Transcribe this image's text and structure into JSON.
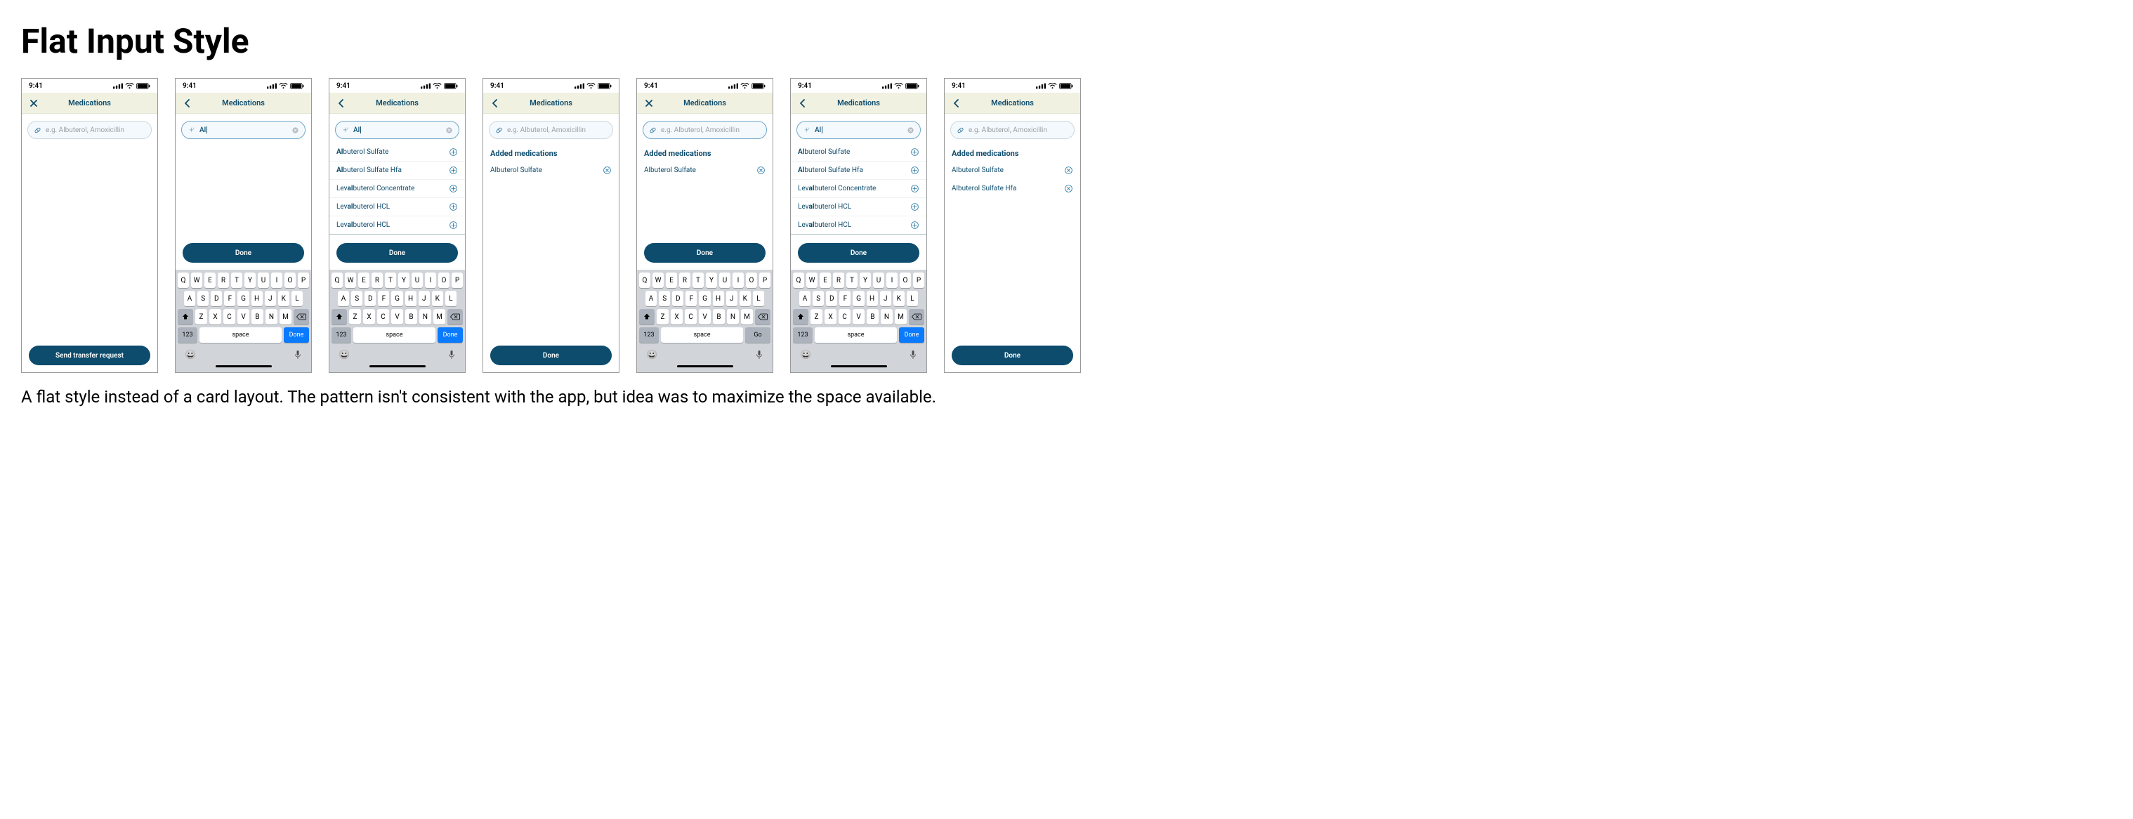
{
  "title": "Flat Input Style",
  "caption": "A flat style instead of a card layout. The pattern isn't consistent with the app, but idea was to maximize the space available.",
  "common": {
    "time": "9:41",
    "nav_title": "Medications",
    "placeholder": "e.g. Albuterol, Amoxicillin",
    "done": "Done",
    "send": "Send transfer request",
    "section_added": "Added medications",
    "kb": {
      "r1": [
        "Q",
        "W",
        "E",
        "R",
        "T",
        "Y",
        "U",
        "I",
        "O",
        "P"
      ],
      "r2": [
        "A",
        "S",
        "D",
        "F",
        "G",
        "H",
        "J",
        "K",
        "L"
      ],
      "r3": [
        "Z",
        "X",
        "C",
        "V",
        "B",
        "N",
        "M"
      ],
      "k123": "123",
      "space": "space",
      "action_done": "Done",
      "action_go": "Go"
    }
  },
  "screens": [
    {
      "nav_left": "close",
      "input": {
        "state": "idle",
        "value": "",
        "leading": "pill",
        "clear": false
      },
      "body": "empty",
      "keyboard": false,
      "footer_btn": "send"
    },
    {
      "nav_left": "back",
      "input": {
        "state": "active",
        "value": "Al",
        "leading": "sparkle",
        "clear": true
      },
      "body": "empty",
      "keyboard": true,
      "keyboard_action": "done",
      "done_above_kb": true
    },
    {
      "nav_left": "back",
      "input": {
        "state": "active",
        "value": "Al",
        "leading": "sparkle",
        "clear": true
      },
      "body": "results",
      "results": [
        {
          "pre": "",
          "match": "Al",
          "post": "buterol Sulfate"
        },
        {
          "pre": "",
          "match": "Al",
          "post": "buterol Sulfate Hfa"
        },
        {
          "pre": "Lev",
          "match": "al",
          "post": "buterol Concentrate"
        },
        {
          "pre": "Lev",
          "match": "al",
          "post": "buterol HCL"
        },
        {
          "pre": "Lev",
          "match": "al",
          "post": "buterol HCL"
        }
      ],
      "keyboard": true,
      "keyboard_action": "done",
      "done_above_kb": true
    },
    {
      "nav_left": "back",
      "input": {
        "state": "idle",
        "value": "",
        "leading": "pill",
        "clear": false
      },
      "body": "added",
      "added": [
        "Albuterol Sulfate"
      ],
      "keyboard": false,
      "footer_btn": "done"
    },
    {
      "nav_left": "close",
      "input": {
        "state": "active",
        "value": "",
        "leading": "pill",
        "clear": false,
        "active_placeholder": true
      },
      "body": "added",
      "added": [
        "Albuterol Sulfate"
      ],
      "keyboard": true,
      "keyboard_action": "go",
      "done_above_kb": true
    },
    {
      "nav_left": "back",
      "input": {
        "state": "active",
        "value": "Al",
        "leading": "sparkle",
        "clear": true
      },
      "body": "results",
      "results": [
        {
          "pre": "",
          "match": "Al",
          "post": "buterol Sulfate"
        },
        {
          "pre": "",
          "match": "Al",
          "post": "buterol Sulfate Hfa"
        },
        {
          "pre": "Lev",
          "match": "al",
          "post": "buterol Concentrate"
        },
        {
          "pre": "Lev",
          "match": "al",
          "post": "buterol HCL"
        },
        {
          "pre": "Lev",
          "match": "al",
          "post": "buterol HCL"
        }
      ],
      "keyboard": true,
      "keyboard_action": "done",
      "done_above_kb": true
    },
    {
      "nav_left": "back",
      "input": {
        "state": "idle",
        "value": "",
        "leading": "pill",
        "clear": false
      },
      "body": "added",
      "added": [
        "Albuterol Sulfate",
        "Albuterol Sulfate Hfa"
      ],
      "keyboard": false,
      "footer_btn": "done"
    }
  ]
}
